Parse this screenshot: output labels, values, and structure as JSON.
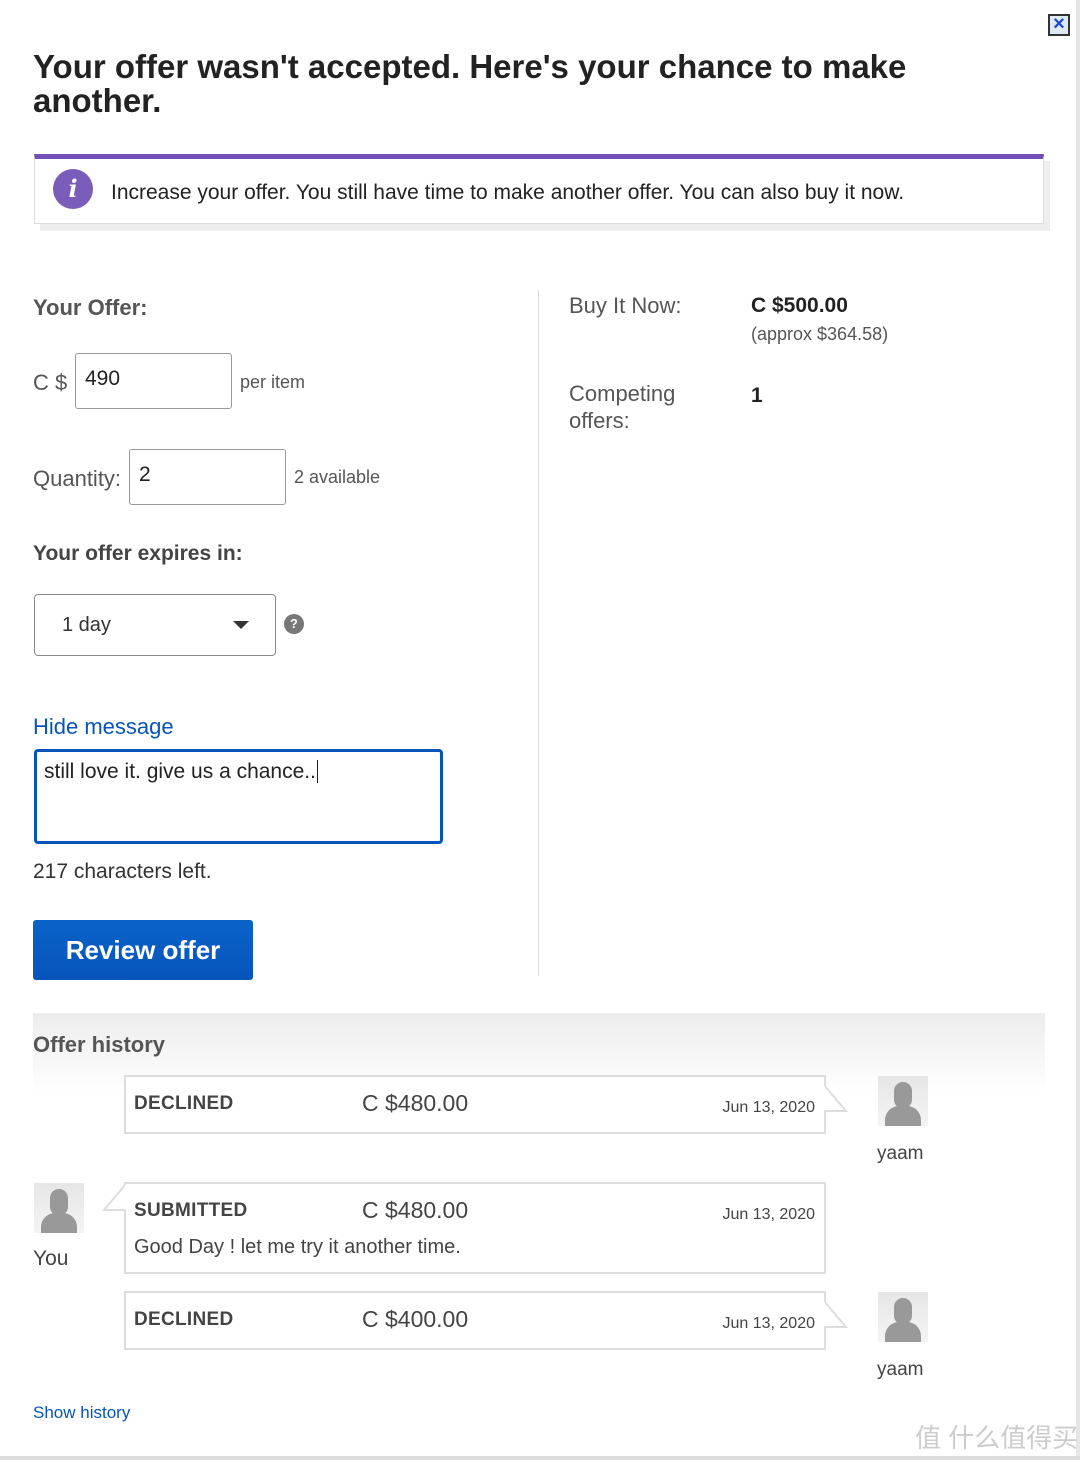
{
  "dialog": {
    "close_icon": "close-x-icon",
    "title": "Your offer wasn't accepted. Here's your chance to make another."
  },
  "banner": {
    "icon": "info-icon",
    "icon_glyph": "i",
    "text": "Increase your offer. You still have time to make another offer. You can also buy it now.",
    "accent": "#7350b8"
  },
  "offer": {
    "label": "Your Offer:",
    "currency": "C $",
    "value": "490",
    "unit": "per item",
    "quantity_label": "Quantity:",
    "quantity": "2",
    "available": "2 available",
    "expires_label": "Your offer expires in:",
    "expires_value": "1 day",
    "help_glyph": "?",
    "hide_message": "Hide message",
    "message": "still love it. give us a chance..",
    "chars_left": "217 characters left.",
    "review_button": "Review offer"
  },
  "summary": {
    "bin_label": "Buy It Now:",
    "bin_price": "C $500.00",
    "bin_approx": "(approx $364.58)",
    "competing_label": "Competing offers:",
    "competing_value": "1"
  },
  "history": {
    "title": "Offer history",
    "items": [
      {
        "status": "DECLINED",
        "amount": "C $480.00",
        "date": "Jun 13, 2020",
        "user": "yaam",
        "side": "seller"
      },
      {
        "status": "SUBMITTED",
        "amount": "C $480.00",
        "date": "Jun 13, 2020",
        "note": "Good Day ! let me try it another time.",
        "user": "You",
        "side": "buyer"
      },
      {
        "status": "DECLINED",
        "amount": "C $400.00",
        "date": "Jun 13, 2020",
        "user": "yaam",
        "side": "seller"
      }
    ],
    "show_history": "Show history"
  },
  "watermark": "值 什么值得买",
  "colors": {
    "link": "#0654ba",
    "button": "#0654ba"
  }
}
